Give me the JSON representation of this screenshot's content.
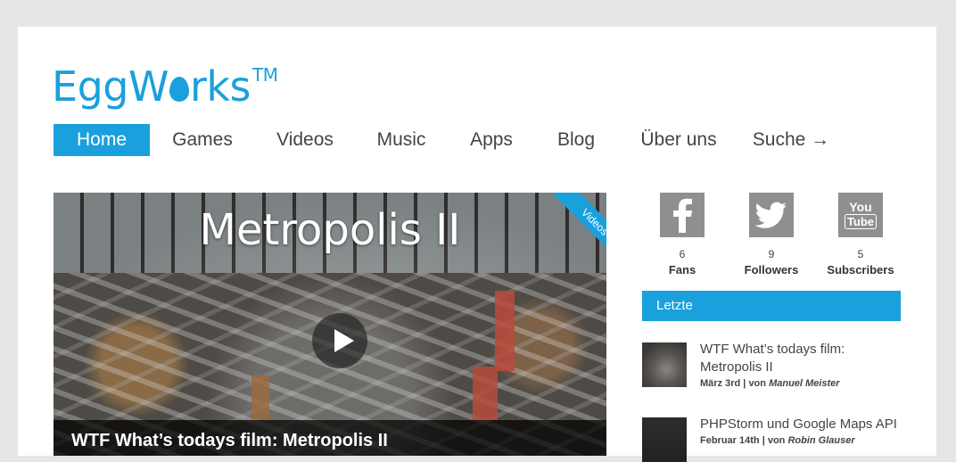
{
  "logo": {
    "text_part1": "EggW",
    "text_part2": "rks",
    "tm": "TM"
  },
  "nav": [
    {
      "label": "Home",
      "active": true
    },
    {
      "label": "Games"
    },
    {
      "label": "Videos"
    },
    {
      "label": "Music"
    },
    {
      "label": "Apps"
    },
    {
      "label": "Blog"
    },
    {
      "label": "Über uns"
    },
    {
      "label": "Suche →"
    }
  ],
  "hero": {
    "title": "Metropolis II",
    "ribbon": "Videos",
    "caption": "WTF What’s todays film: Metropolis II"
  },
  "social": [
    {
      "icon": "facebook-icon",
      "count": "6",
      "label": "Fans"
    },
    {
      "icon": "twitter-icon",
      "count": "9",
      "label": "Followers"
    },
    {
      "icon": "youtube-icon",
      "count": "5",
      "label": "Subscribers"
    }
  ],
  "sidebar": {
    "letzte": "Letzte",
    "posts": [
      {
        "title": "WTF What’s todays film: Metropolis II",
        "date": "März 3rd",
        "sep": " | von ",
        "author": "Manuel Meister"
      },
      {
        "title": "PHPStorm und Google Maps API",
        "date": "Februar 14th",
        "sep": " | von ",
        "author": "Robin Glauser"
      }
    ]
  },
  "colors": {
    "accent": "#1aa0dc",
    "social_tile": "#8f8f8f"
  }
}
